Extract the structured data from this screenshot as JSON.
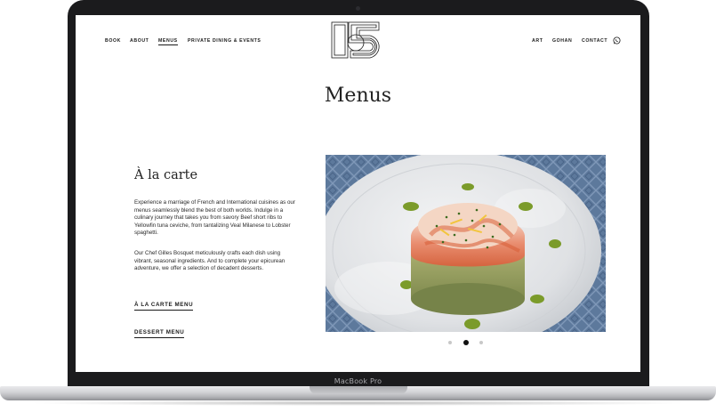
{
  "device": {
    "label": "MacBook Pro"
  },
  "nav": {
    "left": [
      {
        "label": "BOOK",
        "active": false
      },
      {
        "label": "ABOUT",
        "active": false
      },
      {
        "label": "MENUS",
        "active": true
      },
      {
        "label": "PRIVATE DINING & EVENTS",
        "active": false
      }
    ],
    "right": [
      {
        "label": "ART"
      },
      {
        "label": "GOHAN"
      },
      {
        "label": "CONTACT"
      }
    ],
    "whatsapp_icon": "whatsapp-icon"
  },
  "logo": {
    "icon": "restaurant-logo"
  },
  "page": {
    "title": "Menus"
  },
  "section": {
    "title": "À la carte",
    "paragraph_1": "Experience a marriage of French and International cuisines as our menus seamlessly blend the best of both worlds. Indulge in a culinary journey that takes you from savory Beef short ribs to Yellowfin tuna ceviche, from tantalizing Veal Milanese to Lobster spaghetti.",
    "paragraph_2": "Our Chef Gilles Bosquet meticulously crafts each dish using vibrant, seasonal ingredients. And to complete your epicurean adventure, we offer a selection of decadent desserts.",
    "link_a_la_carte": "À LA CARTE MENU",
    "link_dessert": "DESSERT MENU"
  },
  "carousel": {
    "slide_count": 3,
    "active_index": 1
  },
  "colors": {
    "text": "#1a1a1a",
    "frame": "#1b1b1d",
    "plate": "#e6e7e9",
    "tablecloth": "#5f7b9e"
  }
}
